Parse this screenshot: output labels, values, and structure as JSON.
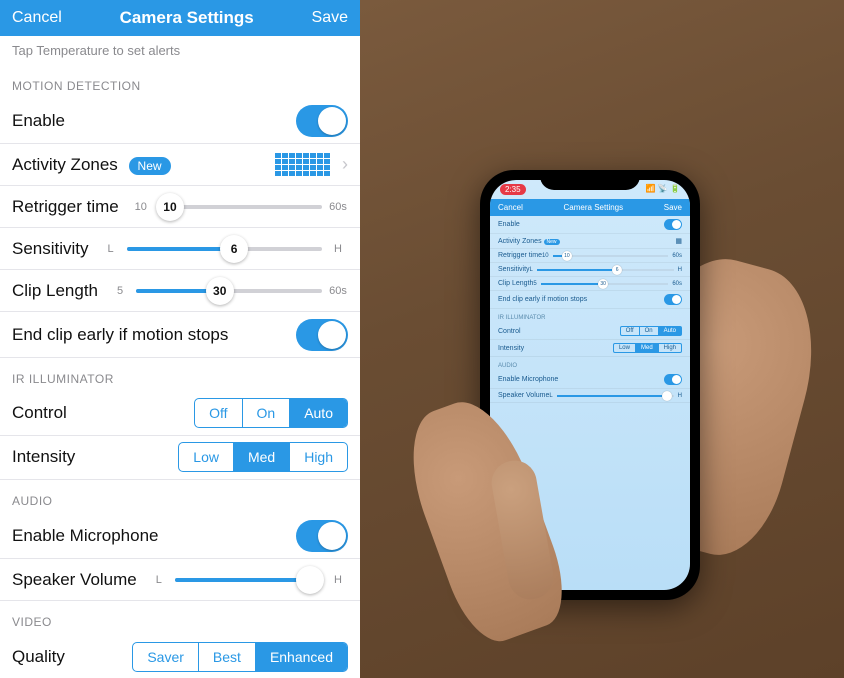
{
  "header": {
    "cancel": "Cancel",
    "title": "Camera Settings",
    "save": "Save"
  },
  "hint": "Tap Temperature to set alerts",
  "sections": {
    "motion": {
      "title": "MOTION DETECTION",
      "enable_label": "Enable",
      "zones_label": "Activity Zones",
      "zones_badge": "New",
      "retrigger_label": "Retrigger time",
      "retrigger_min": "10",
      "retrigger_max": "60s",
      "retrigger_val": "10",
      "retrigger_pct": 8,
      "sensitivity_label": "Sensitivity",
      "sensitivity_min": "L",
      "sensitivity_max": "H",
      "sensitivity_val": "6",
      "sensitivity_pct": 55,
      "clip_label": "Clip Length",
      "clip_min": "5",
      "clip_max": "60s",
      "clip_val": "30",
      "clip_pct": 45,
      "endclip_label": "End clip early if motion stops"
    },
    "ir": {
      "title": "IR ILLUMINATOR",
      "control_label": "Control",
      "control_opts": [
        "Off",
        "On",
        "Auto"
      ],
      "control_sel": 2,
      "intensity_label": "Intensity",
      "intensity_opts": [
        "Low",
        "Med",
        "High"
      ],
      "intensity_sel": 1
    },
    "audio": {
      "title": "AUDIO",
      "mic_label": "Enable Microphone",
      "speaker_label": "Speaker Volume",
      "speaker_min": "L",
      "speaker_max": "H",
      "speaker_pct": 92
    },
    "video": {
      "title": "VIDEO",
      "quality_label": "Quality",
      "quality_opts": [
        "Saver",
        "Best",
        "Enhanced"
      ],
      "quality_sel": 2
    }
  },
  "phone": {
    "time": "2:35",
    "header": {
      "cancel": "Cancel",
      "title": "Camera Settings",
      "save": "Save"
    }
  }
}
